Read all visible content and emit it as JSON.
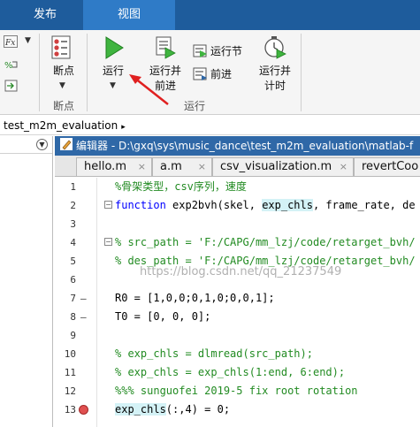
{
  "ribbon_tabs": {
    "publish": "发布",
    "view": "视图"
  },
  "ribbon": {
    "breakpoints_label": "断点",
    "breakpoints_group": "断点",
    "run_label": "运行",
    "run_advance_label_1": "运行并",
    "run_advance_label_2": "前进",
    "run_section_label": "运行节",
    "advance_label": "前进",
    "run_time_label_1": "运行并",
    "run_time_label_2": "计时",
    "run_group": "运行"
  },
  "breadcrumb": {
    "folder": "test_m2m_evaluation",
    "arrow": "▸"
  },
  "editor": {
    "title": "编辑器 - D:\\gxq\\sys\\music_dance\\test_m2m_evaluation\\matlab-f",
    "tabs": [
      {
        "label": "hello.m"
      },
      {
        "label": "a.m"
      },
      {
        "label": "csv_visualization.m"
      },
      {
        "label": "revertCoo"
      }
    ],
    "close_glyph": "×"
  },
  "code_lines": [
    {
      "num": "1",
      "text": "%骨架类型，csv序列，速度"
    },
    {
      "num": "2",
      "kw": "function ",
      "pre": "exp2bvh(skel, ",
      "hl": "exp_chls",
      "post": ", frame_rate, de"
    },
    {
      "num": "3",
      "text": ""
    },
    {
      "num": "4",
      "text": "% src_path = 'F:/CAPG/mm_lzj/code/retarget_bvh/"
    },
    {
      "num": "5",
      "text": "% des_path = 'F:/CAPG/mm_lzj/code/retarget_bvh/"
    },
    {
      "num": "6",
      "text": ""
    },
    {
      "num": "7",
      "text": "R0 = [1,0,0;0,1,0;0,0,1];"
    },
    {
      "num": "8",
      "text": "T0 = [0, 0, 0];"
    },
    {
      "num": "9",
      "text": ""
    },
    {
      "num": "10",
      "text": "% exp_chls = dlmread(src_path);"
    },
    {
      "num": "11",
      "text": "% exp_chls = exp_chls(1:end, 6:end);"
    },
    {
      "num": "12",
      "text": "%%% sunguofei 2019-5 fix root rotation"
    },
    {
      "num": "13",
      "hl": "exp_chls",
      "post": "(:,4) = 0;"
    }
  ],
  "watermark": "https://blog.csdn.net/qq_21237549",
  "colors": {
    "ribbon_tab_bg": "#1e5c9c",
    "editor_title_bg": "#2f68a7",
    "comment": "#228b22",
    "keyword": "#0000ff",
    "string": "#a020f0",
    "highlight": "#d4f2f6",
    "breakpoint": "#e05050",
    "annotation_arrow": "#e02020"
  }
}
